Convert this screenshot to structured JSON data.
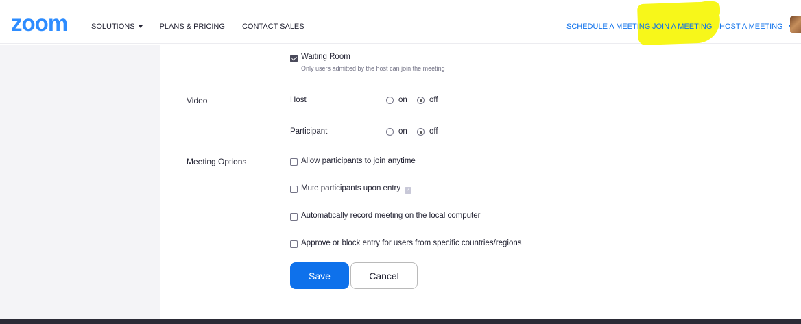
{
  "header": {
    "logo": "zoom",
    "nav_left": [
      "SOLUTIONS",
      "PLANS & PRICING",
      "CONTACT SALES"
    ],
    "nav_right": {
      "schedule": "SCHEDULE A MEETING",
      "join": "JOIN A MEETING",
      "host": "HOST A MEETING"
    },
    "accent_color": "#0E71EB",
    "highlight_color": "#f7f71a"
  },
  "settings": {
    "waiting_room": {
      "label": "Waiting Room",
      "description": "Only users admitted by the host can join the meeting",
      "checked": true
    },
    "video": {
      "label": "Video",
      "host": {
        "label": "Host",
        "on": "on",
        "off": "off",
        "selected": "off"
      },
      "participant": {
        "label": "Participant",
        "on": "on",
        "off": "off",
        "selected": "off"
      }
    },
    "meeting_options": {
      "label": "Meeting Options",
      "items": [
        {
          "label": "Allow participants to join anytime",
          "checked": false
        },
        {
          "label": "Mute participants upon entry",
          "checked": false
        },
        {
          "label": "Automatically record meeting on the local computer",
          "checked": false
        },
        {
          "label": "Approve or block entry for users from specific countries/regions",
          "checked": false
        }
      ]
    }
  },
  "buttons": {
    "save": "Save",
    "cancel": "Cancel"
  }
}
